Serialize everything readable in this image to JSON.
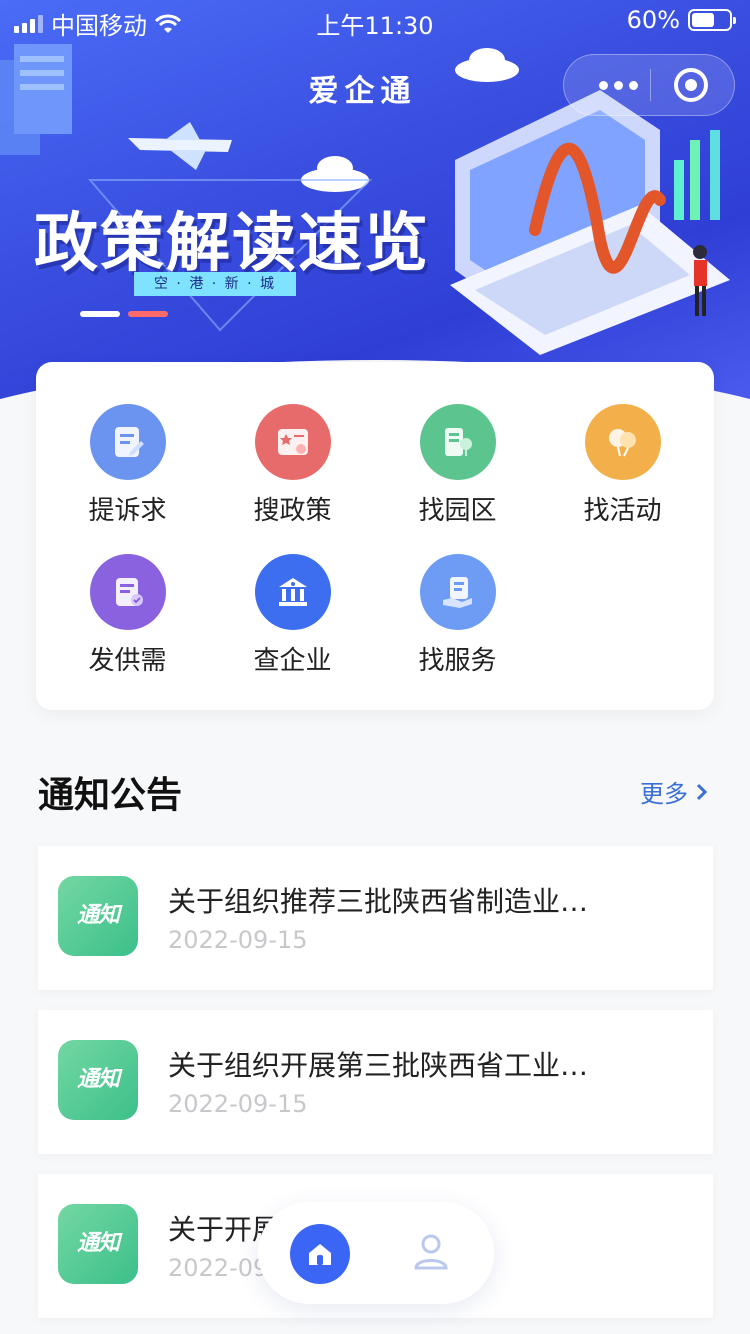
{
  "status_bar": {
    "carrier": "中国移动",
    "time": "上午11:30",
    "battery": "60%",
    "battery_level": 0.6
  },
  "app": {
    "title": "爱企通"
  },
  "banner": {
    "headline": "政策解读速览",
    "tag": "空 · 港 · 新 · 城",
    "slides": 2,
    "active_slide": 1
  },
  "grid": {
    "items": [
      {
        "label": "提诉求",
        "icon": "edit-document-icon",
        "color": "#6b93f0"
      },
      {
        "label": "搜政策",
        "icon": "certificate-icon",
        "color": "#e86b6b"
      },
      {
        "label": "找园区",
        "icon": "building-tree-icon",
        "color": "#5cc58f"
      },
      {
        "label": "找活动",
        "icon": "balloons-icon",
        "color": "#f3b04a"
      },
      {
        "label": "发供需",
        "icon": "document-check-icon",
        "color": "#8a62e0"
      },
      {
        "label": "查企业",
        "icon": "bank-icon",
        "color": "#3e6ef0"
      },
      {
        "label": "找服务",
        "icon": "hand-document-icon",
        "color": "#6e9cf5"
      }
    ]
  },
  "notices": {
    "title": "通知公告",
    "more": "更多",
    "items": [
      {
        "badge": "通知",
        "title": "关于组织推荐三批陕西省制造业…",
        "date": "2022-09-15"
      },
      {
        "badge": "通知",
        "title": "关于组织开展第三批陕西省工业…",
        "date": "2022-09-15"
      },
      {
        "badge": "通知",
        "title": "关于开展…级中小企业…",
        "date": "2022-09-15"
      }
    ]
  },
  "bottom_nav": {
    "items": [
      {
        "icon": "home-icon",
        "active": true
      },
      {
        "icon": "user-icon",
        "active": false
      }
    ]
  }
}
